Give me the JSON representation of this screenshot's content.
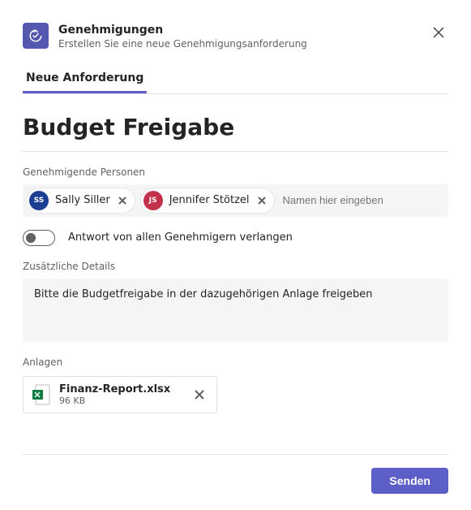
{
  "header": {
    "title": "Genehmigungen",
    "subtitle": "Erstellen Sie eine neue Genehmigungsanforderung"
  },
  "tab_label": "Neue Anforderung",
  "form_title": "Budget Freigabe",
  "approvers": {
    "label": "Genehmigende Personen",
    "people": [
      {
        "initials": "SS",
        "name": "Sally Siller",
        "color": "#1c3f94"
      },
      {
        "initials": "JS",
        "name": "Jennifer Stötzel",
        "color": "#c4314b"
      }
    ],
    "placeholder": "Namen hier eingeben"
  },
  "toggle": {
    "label": "Antwort von allen Genehmigern verlangen",
    "on": false
  },
  "details": {
    "label": "Zusätzliche Details",
    "value": "Bitte die Budgetfreigabe in der dazugehörigen Anlage freigeben"
  },
  "attachments": {
    "label": "Anlagen",
    "files": [
      {
        "name": "Finanz-Report.xlsx",
        "size": "96 KB"
      }
    ]
  },
  "send_label": "Senden"
}
